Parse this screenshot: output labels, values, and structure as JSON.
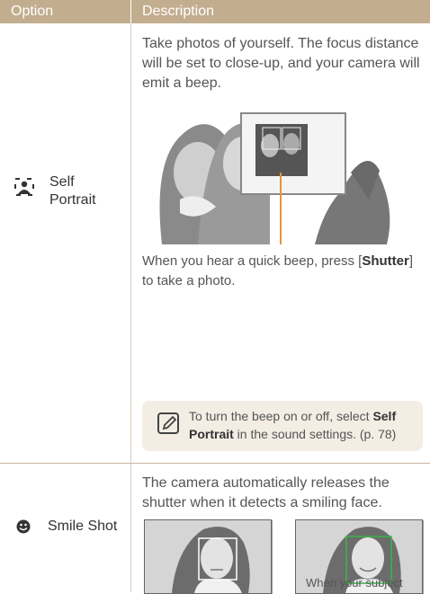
{
  "header": {
    "option": "Option",
    "description": "Description"
  },
  "self_portrait": {
    "icon": "self-portrait-icon",
    "label": "Self Portrait",
    "description": "Take photos of yourself. The focus distance will be set to close-up, and your camera will emit a beep.",
    "caption_pre": "When you hear a quick beep, press [",
    "caption_bold": "Shutter",
    "caption_post": "] to take a photo.",
    "note_icon": "note-pencil-icon",
    "note_pre": "To turn the beep on or off, select ",
    "note_bold": "Self Portrait",
    "note_post": " in the sound settings. (p. 78)"
  },
  "smile_shot": {
    "icon": "smile-face-icon",
    "label": "Smile Shot",
    "description": "The camera automatically releases the shutter when it detects a smiling face.",
    "caption": "When your subject smiles broadly, your camera can detect the smile more easily."
  },
  "colors": {
    "header": "#c3ad8f",
    "note_bg": "#f3ede4",
    "accent_line": "#e8923c",
    "face_box_green": "#39b54a"
  }
}
